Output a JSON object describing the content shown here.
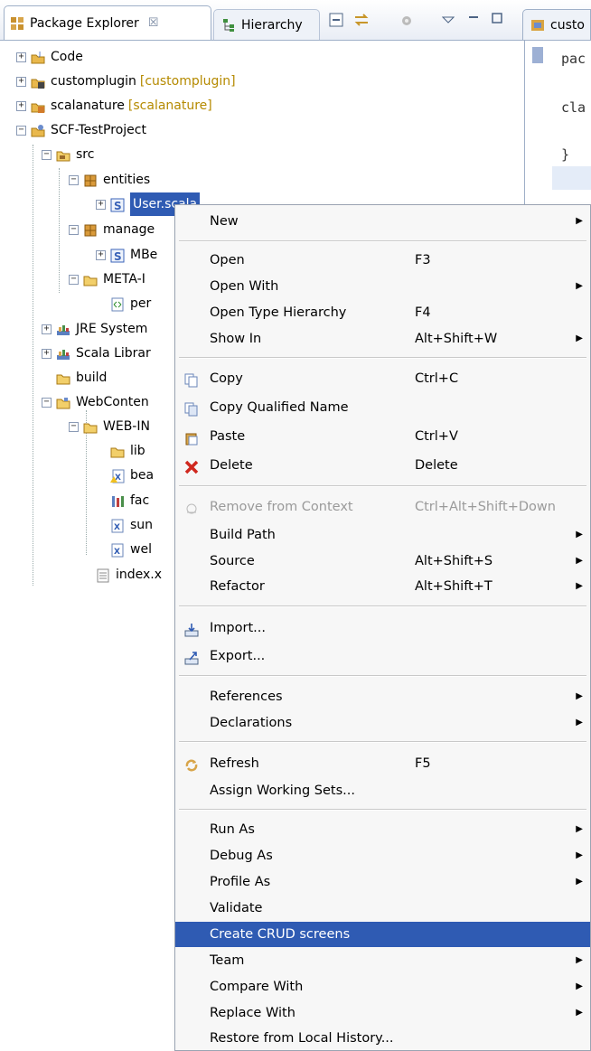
{
  "tabs": {
    "package_explorer": "Package Explorer",
    "hierarchy": "Hierarchy",
    "editor": "custo"
  },
  "icons": {
    "close": "close-x-icon",
    "collapse_all": "collapse-all-icon",
    "link_editor": "link-with-editor-icon",
    "view_menu": "view-menu-icon",
    "minimize": "minimize-icon",
    "maximize": "maximize-icon"
  },
  "tree": {
    "code": "Code",
    "customplugin": "customplugin",
    "customplugin_deco": "[customplugin]",
    "scalanature": "scalanature",
    "scalanature_deco": "[scalanature]",
    "scf": "SCF-TestProject",
    "src": "src",
    "entities": "entities",
    "user_scala": "User.scala",
    "managed": "manage",
    "mbean": "MBe",
    "meta_inf": "META-I",
    "persistence": "per",
    "jre": "JRE System",
    "scala_lib": "Scala Librar",
    "build": "build",
    "webcontent": "WebConten",
    "webinf": "WEB-IN",
    "lib": "lib",
    "beans": "bea",
    "faces": "fac",
    "sun": "sun",
    "web": "wel",
    "index": "index.x"
  },
  "editor": {
    "line1": "pac",
    "line2": "cla",
    "line3": "}"
  },
  "menu": {
    "new": "New",
    "open": "Open",
    "open_acc": "F3",
    "open_with": "Open With",
    "open_type_hierarchy": "Open Type Hierarchy",
    "open_type_hierarchy_acc": "F4",
    "show_in": "Show In",
    "show_in_acc": "Alt+Shift+W",
    "copy": "Copy",
    "copy_acc": "Ctrl+C",
    "copy_qualified": "Copy Qualified Name",
    "paste": "Paste",
    "paste_acc": "Ctrl+V",
    "delete": "Delete",
    "delete_acc": "Delete",
    "remove_context": "Remove from Context",
    "remove_context_acc": "Ctrl+Alt+Shift+Down",
    "build_path": "Build Path",
    "source": "Source",
    "source_acc": "Alt+Shift+S",
    "refactor": "Refactor",
    "refactor_acc": "Alt+Shift+T",
    "import": "Import...",
    "export": "Export...",
    "references": "References",
    "declarations": "Declarations",
    "refresh": "Refresh",
    "refresh_acc": "F5",
    "assign_working_sets": "Assign Working Sets...",
    "run_as": "Run As",
    "debug_as": "Debug As",
    "profile_as": "Profile As",
    "validate": "Validate",
    "create_crud": "Create CRUD screens",
    "team": "Team",
    "compare_with": "Compare With",
    "replace_with": "Replace With",
    "restore_history": "Restore from Local History..."
  }
}
